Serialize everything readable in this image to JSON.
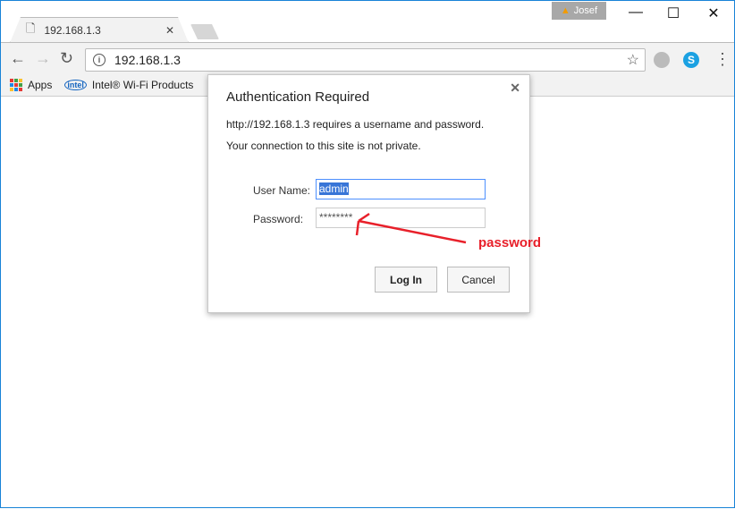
{
  "window": {
    "profile_name": "Josef",
    "minimize": "—",
    "maximize": "☐",
    "close": "✕"
  },
  "tab": {
    "title": "192.168.1.3",
    "close": "✕"
  },
  "toolbar": {
    "back": "←",
    "forward": "→",
    "reload": "↻",
    "url": "192.168.1.3",
    "menu": "⋮",
    "skype": "S"
  },
  "bookmarks": {
    "apps": "Apps",
    "intel": "Intel® Wi-Fi Products"
  },
  "dialog": {
    "title": "Authentication Required",
    "message": "http://192.168.1.3 requires a username and password.",
    "warning": "Your connection to this site is not private.",
    "username_label": "User Name:",
    "username_value": "admin",
    "password_label": "Password:",
    "password_value": "********",
    "login": "Log In",
    "cancel": "Cancel",
    "close": "✕"
  },
  "annotation": {
    "text": "password",
    "color": "#e8202a"
  },
  "colors": {
    "accent": "#1883d7",
    "selection": "#3875d7"
  }
}
